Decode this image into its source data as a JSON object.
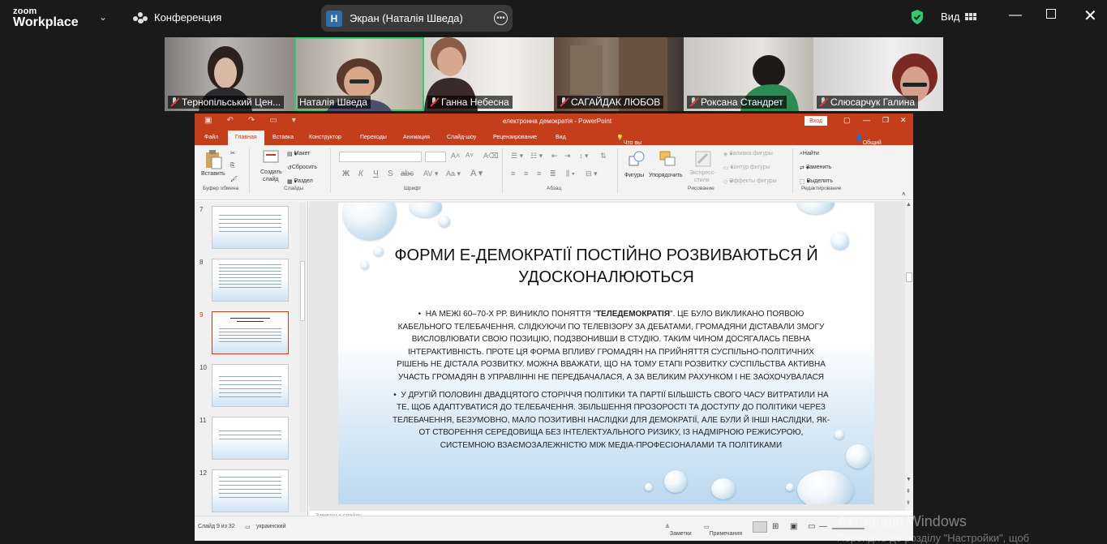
{
  "zoom": {
    "logo_line1": "zoom",
    "logo_line2": "Workplace",
    "conference_label": "Конференция",
    "share_initial": "Н",
    "share_label": "Экран (Наталія Шведа)",
    "view_label": "Вид"
  },
  "participants": [
    {
      "name": "Тернопільський Цен...",
      "muted": true
    },
    {
      "name": "Наталія Шведа",
      "muted": false,
      "active": true
    },
    {
      "name": "Ганна Небесна",
      "muted": true
    },
    {
      "name": "САГАЙДАК ЛЮБОВ",
      "muted": true
    },
    {
      "name": "Роксана Стандрет",
      "muted": true
    },
    {
      "name": "Слюсарчук Галина",
      "muted": true
    }
  ],
  "ppt": {
    "window_title": "електронна демократія  -  PowerPoint",
    "signin": "Вход",
    "tabs": [
      "Файл",
      "Главная",
      "Вставка",
      "Конструктор",
      "Переходы",
      "Анимация",
      "Слайд-шоу",
      "Рецензирование",
      "Вид"
    ],
    "active_tab": "Главная",
    "tell_me": "Что вы хотите сделать?",
    "share": "Общий доступ",
    "ribbon": {
      "paste": "Вставить",
      "clipboard_group": "Буфер обмена",
      "new_slide_1": "Создать",
      "new_slide_2": "слайд",
      "layout": "Макет",
      "reset": "Сбросить",
      "section": "Раздел",
      "slides_group": "Слайды",
      "font_group": "Шрифт",
      "paragraph_group": "Абзац",
      "shapes": "Фигуры",
      "arrange": "Упорядочить",
      "quick_styles_1": "Экспресс-",
      "quick_styles_2": "стили",
      "shape_fill": "Заливка фигуры",
      "shape_outline": "Контур фигуры",
      "shape_effects": "Эффекты фигуры",
      "drawing_group": "Рисование",
      "find": "Найти",
      "replace": "Заменить",
      "select": "Выделить",
      "editing_group": "Редактирование"
    },
    "slide_numbers": [
      "7",
      "8",
      "9",
      "10",
      "11",
      "12"
    ],
    "selected_slide": "9",
    "slide": {
      "title": "Форми е-демократії постійно розвиваються й удосконалюються",
      "bullet1_pre": "На межі 60–70-х рр. виникло поняття \"",
      "bullet1_bold": "теледемократія",
      "bullet1_post": "\". Це було викликано появою кабельного телебачення. Слідкуючи по телевізору за дебатами, громадяни діставали змогу висловлювати свою позицію, подзвонивши в студію. Таким чином досягалась певна інтерактивність. Проте ця форма впливу громадян на прийняття суспільно-політичних рішень не дістала розвитку. Можна вважати, що на тому етапі розвитку суспільства активна участь громадян в управлінні не передбачалася, а за великим рахунком і не заохочувалася",
      "bullet2": "У другій половині двадцятого сторіччя політики та партії більшість свого часу витратили на те, щоб адаптуватися до телебачення. Збільшення прозорості та доступу до політики через телебачення, безумовно, мало позитивні наслідки для демократії, але були й інші наслідки, як-от створення середовища без інтелектуального ризику, із надмірною режисурою, системною взаємозалежністю між медіа-професіоналами та політиками"
    },
    "notes_placeholder": "Заметки к слайду",
    "status": {
      "slide_of": "Слайд 9 из 32",
      "language": "украинский",
      "notes": "Заметки",
      "comments": "Примечания"
    }
  },
  "windows_watermark": {
    "line1": "Активація Windows",
    "line2": "Перейдіть до розділу \"Настройки\", щоб"
  },
  "colors": {
    "zoom_bg": "#1a1a1a",
    "ppt_accent": "#c43e1c",
    "active_speaker": "#2ecc71",
    "shield": "#2ecc71"
  }
}
